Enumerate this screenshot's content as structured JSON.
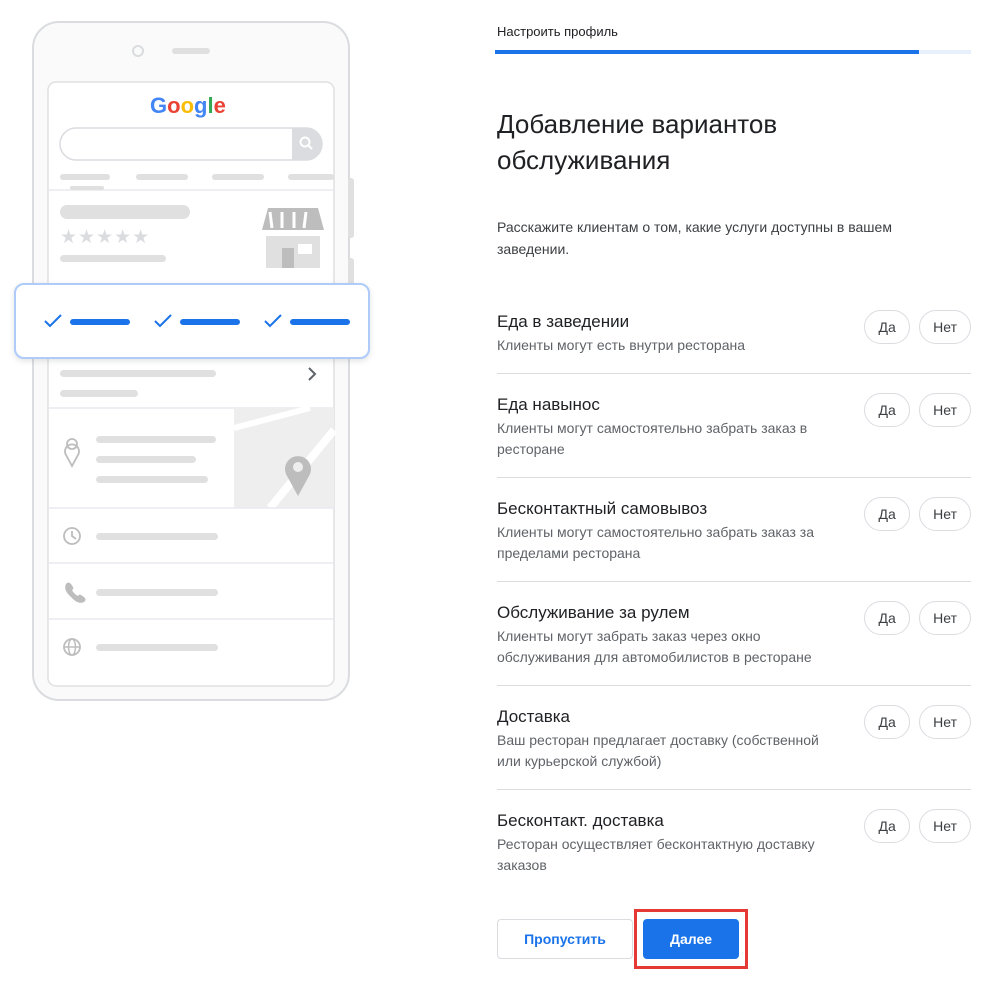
{
  "illustration": {
    "brand": "Google",
    "brand_colors": [
      "#4285F4",
      "#EA4335",
      "#FBBC05",
      "#4285F4",
      "#34A853",
      "#EA4335"
    ],
    "stars": "★★★★★"
  },
  "header": {
    "step_label": "Настроить профиль",
    "progress_fraction": 0.89
  },
  "main": {
    "title": "Добавление вариантов обслуживания",
    "description": "Расскажите клиентам о том, какие услуги доступны в вашем заведении."
  },
  "options": [
    {
      "title": "Еда в заведении",
      "subtitle": "Клиенты могут есть внутри ресторана",
      "yes": "Да",
      "no": "Нет"
    },
    {
      "title": "Еда навынос",
      "subtitle": "Клиенты могут самостоятельно забрать заказ в ресторане",
      "yes": "Да",
      "no": "Нет"
    },
    {
      "title": "Бесконтактный самовывоз",
      "subtitle": "Клиенты могут самостоятельно забрать заказ за пределами ресторана",
      "yes": "Да",
      "no": "Нет"
    },
    {
      "title": "Обслуживание за рулем",
      "subtitle": "Клиенты могут забрать заказ через окно обслуживания для автомобилистов в ресторане",
      "yes": "Да",
      "no": "Нет"
    },
    {
      "title": "Доставка",
      "subtitle": "Ваш ресторан предлагает доставку (собственной или курьерской службой)",
      "yes": "Да",
      "no": "Нет"
    },
    {
      "title": "Бесконтакт. доставка",
      "subtitle": "Ресторан осуществляет бесконтактную доставку заказов",
      "yes": "Да",
      "no": "Нет"
    }
  ],
  "footer": {
    "skip_label": "Пропустить",
    "next_label": "Далее"
  },
  "colors": {
    "accent": "#1a73e8",
    "highlight_border": "#e53935"
  }
}
